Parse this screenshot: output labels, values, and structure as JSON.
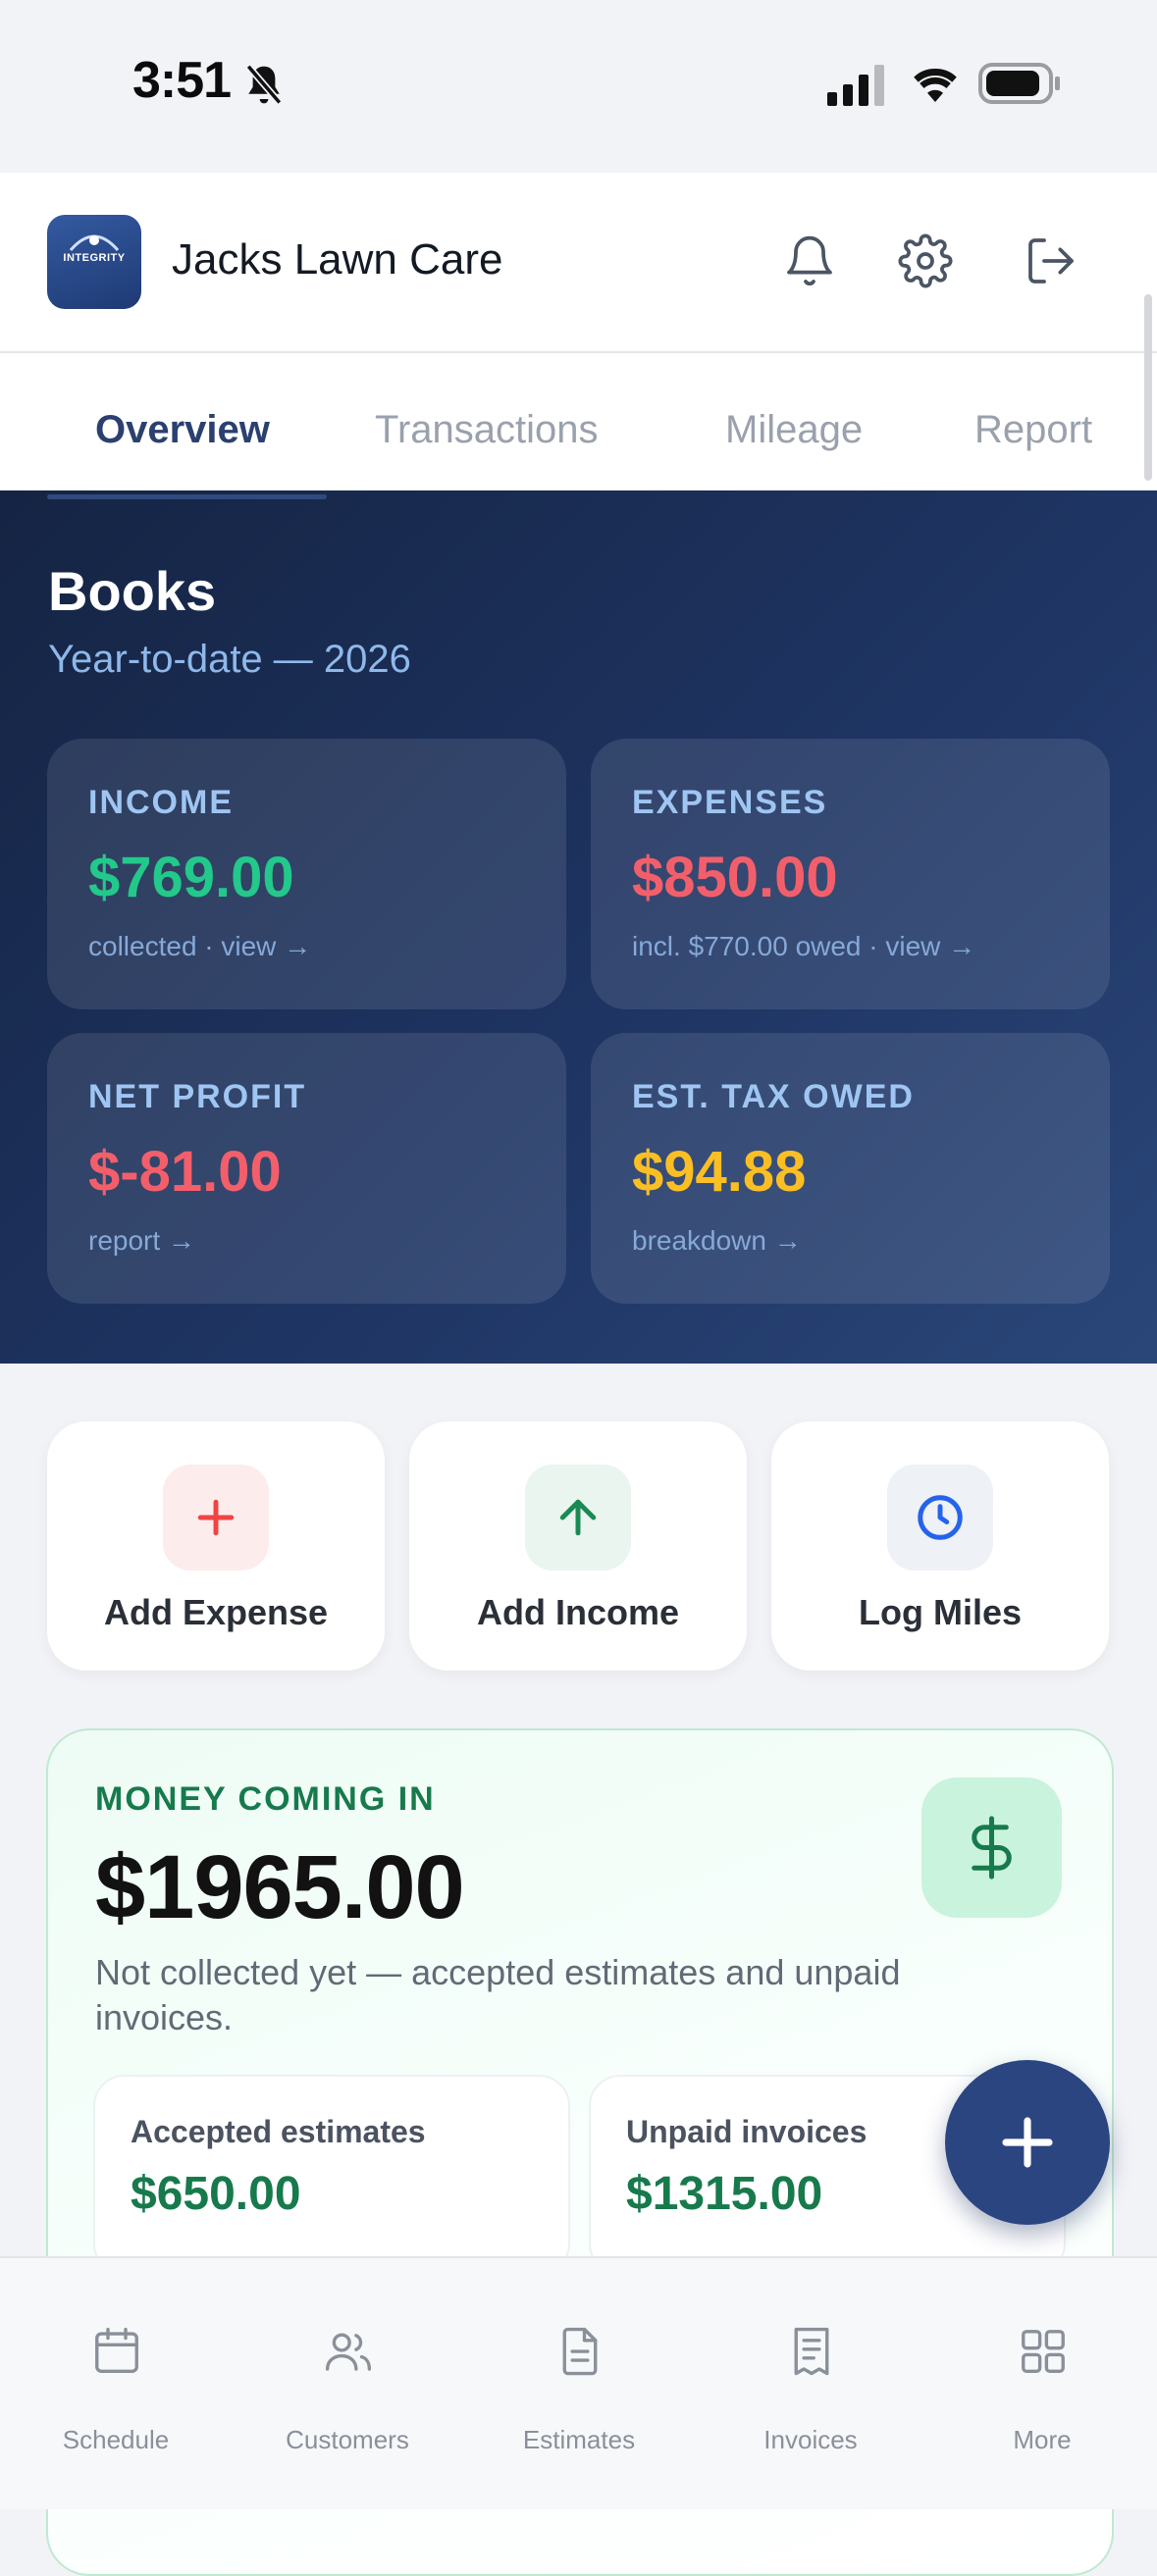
{
  "status_bar": {
    "time": "3:51"
  },
  "header": {
    "business_name": "Jacks Lawn Care",
    "logo_text": "INTEGRITY"
  },
  "tabs": [
    {
      "label": "Overview",
      "active": true
    },
    {
      "label": "Transactions",
      "active": false
    },
    {
      "label": "Mileage",
      "active": false
    },
    {
      "label": "Report",
      "active": false
    }
  ],
  "books": {
    "title": "Books",
    "subtitle": "Year-to-date — 2026",
    "cards": {
      "income": {
        "label": "INCOME",
        "value": "$769.00",
        "link": "collected · view →",
        "color": "#22c98a"
      },
      "expenses": {
        "label": "EXPENSES",
        "value": "$850.00",
        "link": "incl. $770.00 owed · view →",
        "color": "#f25f6b"
      },
      "net_profit": {
        "label": "NET PROFIT",
        "value": "$-81.00",
        "link": "report →",
        "color": "#f25f6b"
      },
      "tax": {
        "label": "EST. TAX OWED",
        "value": "$94.88",
        "link": "breakdown →",
        "color": "#fbbf24"
      }
    }
  },
  "quick_actions": [
    {
      "label": "Add Expense",
      "icon": "plus-icon"
    },
    {
      "label": "Add Income",
      "icon": "arrow-up-icon"
    },
    {
      "label": "Log Miles",
      "icon": "clock-icon"
    }
  ],
  "money_coming_in": {
    "label": "MONEY COMING IN",
    "amount": "$1965.00",
    "description": "Not collected yet — accepted estimates and unpaid invoices.",
    "accepted_estimates": {
      "label": "Accepted estimates",
      "value": "$650.00"
    },
    "unpaid_invoices": {
      "label": "Unpaid invoices",
      "value": "$1315.00"
    }
  },
  "bottom_nav": [
    {
      "label": "Schedule",
      "icon": "calendar-icon"
    },
    {
      "label": "Customers",
      "icon": "users-icon"
    },
    {
      "label": "Estimates",
      "icon": "document-icon"
    },
    {
      "label": "Invoices",
      "icon": "receipt-icon"
    },
    {
      "label": "More",
      "icon": "grid-icon"
    }
  ],
  "colors": {
    "accent": "#2b4580",
    "positive": "#177a4c",
    "hero_dark": "#152443"
  }
}
